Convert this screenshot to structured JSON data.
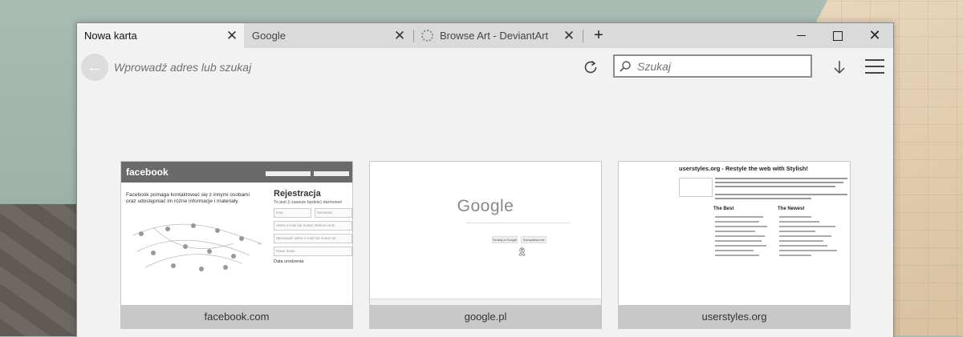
{
  "tabs": [
    {
      "label": "Nowa karta",
      "active": true
    },
    {
      "label": "Google",
      "active": false
    },
    {
      "label": "Browse Art - DeviantArt",
      "active": false,
      "loading": true
    }
  ],
  "toolbar": {
    "address_placeholder": "Wprowadź adres lub szukaj",
    "search_placeholder": "Szukaj"
  },
  "top_sites": [
    {
      "label": "facebook.com"
    },
    {
      "label": "google.pl"
    },
    {
      "label": "userstyles.org"
    }
  ],
  "thumbs": {
    "facebook": {
      "logo": "facebook",
      "tagline": "Facebook pomaga kontaktować się z innymi osobami oraz udostępniać im różne informacje i materiały.",
      "register_title": "Rejestracja",
      "register_sub": "To jest (i zawsze będzie) darmowe!",
      "field_first": "Imię",
      "field_last": "Nazwisko",
      "field_contact": "Adres e-mail lub numer telefonu kom",
      "field_contact2": "Wprowadź adres e-mail lub numer tel",
      "field_password": "Nowe hasło",
      "birthday": "Data urodzenia"
    },
    "google": {
      "logo": "Google",
      "btn_search": "Szukaj w Google",
      "btn_lucky": "Szczęśliwy traf"
    },
    "userstyles": {
      "title": "userstyles.org - Restyle the web with Stylish!",
      "best": "The Best",
      "newest": "The Newest"
    }
  },
  "colors": {
    "tabbar_bg": "#dadada",
    "window_bg": "#f2f2f2",
    "tile_bg": "#c8c8c8"
  }
}
